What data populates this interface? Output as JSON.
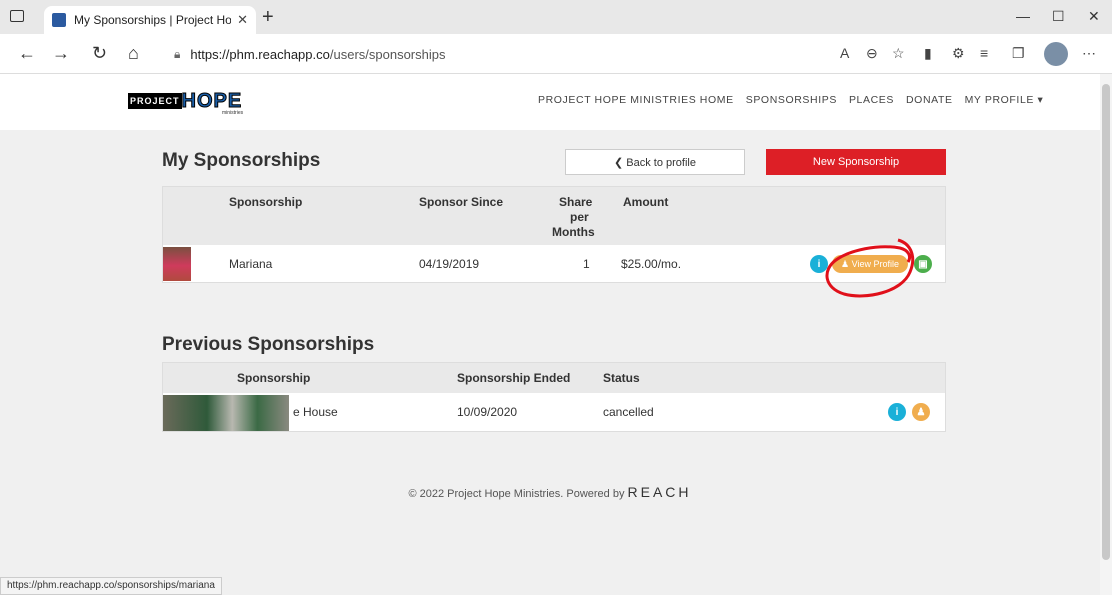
{
  "browser": {
    "tab_title": "My Sponsorships | Project Hope",
    "url_domain": "https://phm.reachapp.co",
    "url_path": "/users/sponsorships",
    "status_url": "https://phm.reachapp.co/sponsorships/mariana"
  },
  "site": {
    "logo_text_a": "PROJECT",
    "logo_text_b": "HOPE",
    "logo_sub": "ministries",
    "nav": [
      "PROJECT HOPE MINISTRIES HOME",
      "SPONSORSHIPS",
      "PLACES",
      "DONATE",
      "MY PROFILE ▾"
    ]
  },
  "current": {
    "heading": "My Sponsorships",
    "back_label": "❮ Back to profile",
    "new_label": "New Sponsorship",
    "headers": {
      "sponsorship": "Sponsorship",
      "since": "Sponsor Since",
      "share_a": "Share",
      "share_b": "per",
      "share_c": "Months",
      "amount": "Amount"
    },
    "row": {
      "name": "Mariana",
      "since": "04/19/2019",
      "share": "1",
      "amount": "$25.00/mo.",
      "view_label": "♟ View Profile"
    }
  },
  "previous": {
    "heading": "Previous Sponsorships",
    "headers": {
      "sponsorship": "Sponsorship",
      "ended": "Sponsorship Ended",
      "status": "Status"
    },
    "row": {
      "name": "e House",
      "ended": "10/09/2020",
      "status": "cancelled"
    }
  },
  "footer": {
    "text": "© 2022 Project Hope Ministries. Powered by",
    "reach": "REACH"
  },
  "colors": {
    "brand_red": "#dd1f26",
    "info_blue": "#1ab0d8",
    "orange": "#f0ad4e",
    "green": "#4cae4c",
    "annotation_red": "#e0101a"
  }
}
